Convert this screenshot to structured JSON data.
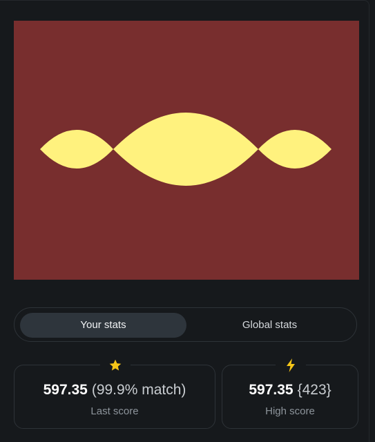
{
  "target_image": {
    "background_color": "#782e2e",
    "shape_color": "#fff27e",
    "shape": "three pointed lens (vesica) shapes in a horizontal row"
  },
  "stats_toggle": {
    "your_stats_label": "Your stats",
    "global_stats_label": "Global stats",
    "active": "your_stats"
  },
  "last_score_card": {
    "icon": "star-icon",
    "value": "597.35",
    "detail": "(99.9% match)",
    "label": "Last score",
    "icon_color": "#f5c518"
  },
  "high_score_card": {
    "icon": "lightning-icon",
    "value": "597.35",
    "detail": "{423}",
    "label": "High score",
    "icon_color": "#f5c518"
  }
}
